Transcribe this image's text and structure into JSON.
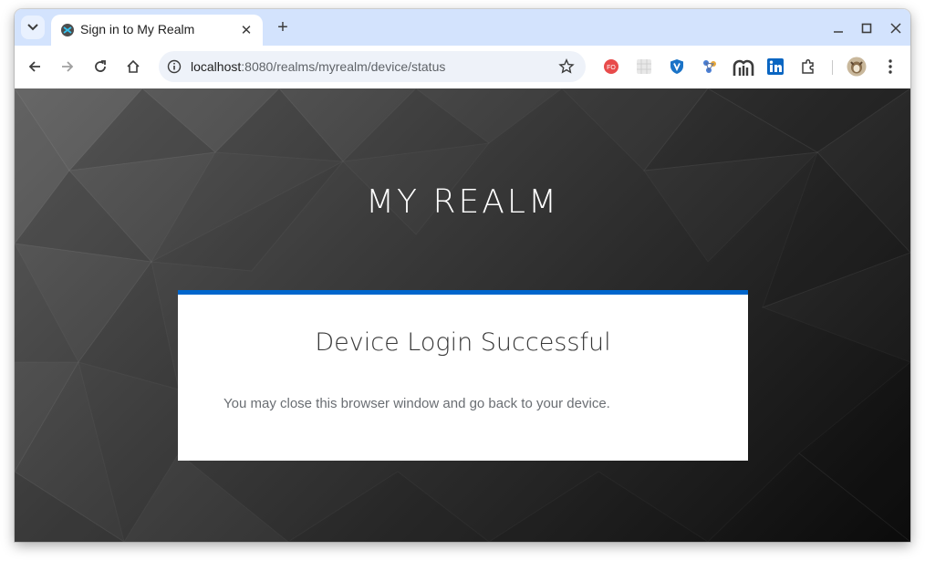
{
  "browser": {
    "tab": {
      "title": "Sign in to My Realm",
      "favicon": "keycloak-icon"
    },
    "new_tab_label": "+",
    "address": {
      "host": "localhost",
      "rest": ":8080/realms/myrealm/device/status"
    },
    "extensions": [
      "fo-extension-icon",
      "grid-extension-icon",
      "shield-extension-icon",
      "network-extension-icon",
      "metamask-like-extension-icon",
      "linkedin-icon",
      "puzzle-icon",
      "profile-avatar"
    ],
    "colors": {
      "tabstrip": "#d3e3fd",
      "omnibox": "#eef2f9"
    }
  },
  "page": {
    "realm_title": "MY REALM",
    "card": {
      "title": "Device Login Successful",
      "message": "You may close this browser window and go back to your device."
    },
    "colors": {
      "accent": "#0066cc",
      "card_bg": "#ffffff"
    }
  }
}
